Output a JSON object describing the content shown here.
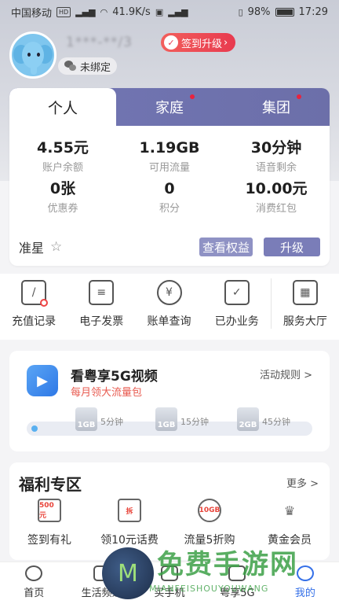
{
  "status_bar": {
    "carrier": "中国移动",
    "hd": "HD",
    "speed": "41.9K/s",
    "battery": "98%",
    "time": "17:29"
  },
  "profile": {
    "phone_masked": "1***-**/3",
    "signin_label": "签到升级",
    "wechat_label": "未绑定"
  },
  "account_tabs": [
    {
      "label": "个人",
      "active": true,
      "dot": false
    },
    {
      "label": "家庭",
      "active": false,
      "dot": true
    },
    {
      "label": "集团",
      "active": false,
      "dot": true
    }
  ],
  "stats": [
    {
      "value": "4.55元",
      "label": "账户余额"
    },
    {
      "value": "1.19GB",
      "label": "可用流量"
    },
    {
      "value": "30分钟",
      "label": "语音剩余"
    },
    {
      "value": "0张",
      "label": "优惠券"
    },
    {
      "value": "0",
      "label": "积分"
    },
    {
      "value": "10.00元",
      "label": "消费红包"
    }
  ],
  "member": {
    "level": "准星",
    "rights_button": "查看权益",
    "upgrade_button": "升级"
  },
  "quick_menu": [
    {
      "label": "充值记录",
      "icon": "recharge-record-icon",
      "glyph": "/"
    },
    {
      "label": "电子发票",
      "icon": "invoice-icon",
      "glyph": "≡"
    },
    {
      "label": "账单查询",
      "icon": "bill-query-icon",
      "glyph": "¥"
    },
    {
      "label": "已办业务",
      "icon": "business-icon",
      "glyph": "✓"
    },
    {
      "label": "服务大厅",
      "icon": "service-hall-icon",
      "glyph": "▦"
    }
  ],
  "video_promo": {
    "title": "看粤享5G视频",
    "subtitle": "每月领大流量包",
    "rules": "活动规则 >",
    "gifts": [
      {
        "amount": "1GB",
        "minutes": "5分钟"
      },
      {
        "amount": "1GB",
        "minutes": "15分钟"
      },
      {
        "amount": "2GB",
        "minutes": "45分钟"
      }
    ]
  },
  "welfare": {
    "title": "福利专区",
    "more": "更多 >",
    "items": [
      {
        "label": "签到有礼",
        "icon": "calendar-gift-icon",
        "glyph": "500元"
      },
      {
        "label": "领10元话费",
        "icon": "coupon-icon",
        "glyph": "拆"
      },
      {
        "label": "流量5折购",
        "icon": "data-bag-icon",
        "glyph": "10GB"
      },
      {
        "label": "黄金会员",
        "icon": "crown-icon",
        "glyph": "♛"
      }
    ]
  },
  "bottom_nav": [
    {
      "label": "首页",
      "icon": "home-icon",
      "active": false
    },
    {
      "label": "生活频道",
      "icon": "life-channel-icon",
      "active": false
    },
    {
      "label": "买手机",
      "icon": "phone-shop-icon",
      "active": false
    },
    {
      "label": "粤享5G",
      "icon": "5g-icon",
      "active": false
    },
    {
      "label": "我的",
      "icon": "mine-icon",
      "active": true
    }
  ],
  "watermark": {
    "text": "免费手游网",
    "sub": "MIANFEISHOUYOUWANG",
    "logo_letter": "M"
  }
}
